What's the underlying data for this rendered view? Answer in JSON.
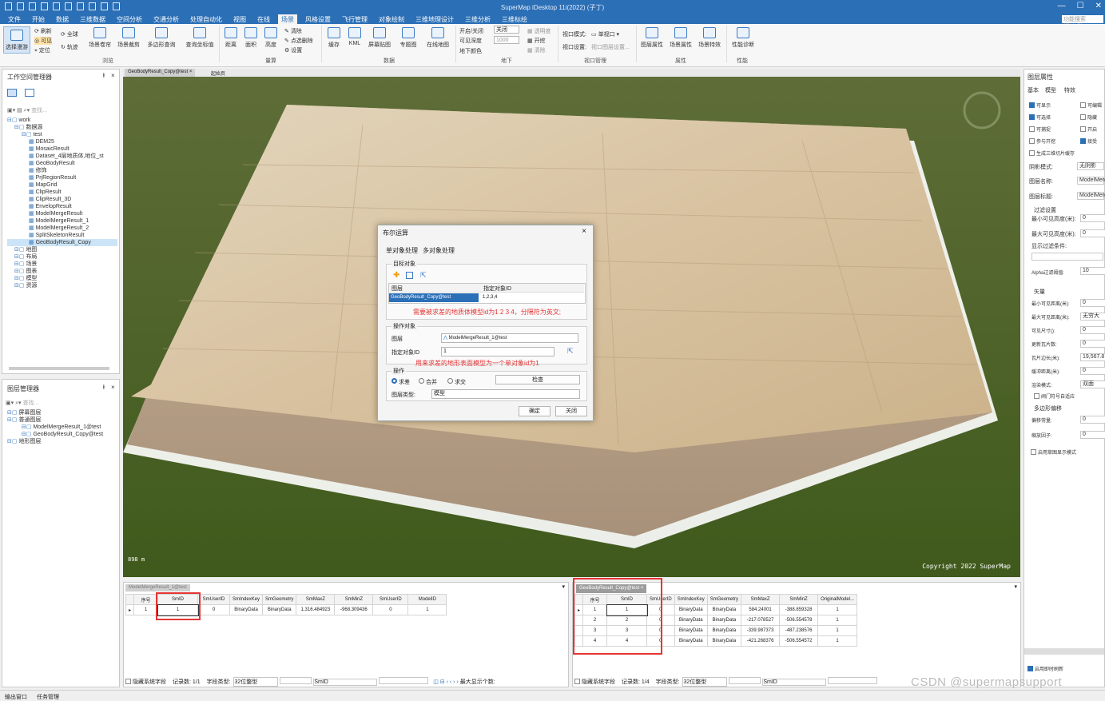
{
  "app": {
    "title": "SuperMap iDesktop 11i(2022) (子丁)"
  },
  "menus": [
    "文件",
    "开始",
    "数据",
    "三维数据",
    "空间分析",
    "交通分析",
    "处理自动化",
    "视图",
    "在线",
    "场景",
    "风格设置",
    "飞行管理",
    "对象绘制",
    "三维地理设计",
    "三维分析",
    "三维标绘"
  ],
  "menu_search_placeholder": "功能搜索 (Ctrl+F)",
  "ribbon": {
    "browse": {
      "select_scene": "选择漫游",
      "refresh": "刷新",
      "visible": "可见",
      "locate": "定位",
      "full": "全球",
      "track": "轨迹",
      "scene_roll": "场景卷帘",
      "scene_spin": "场景裁剪",
      "poly_query": "多边形查询",
      "coord_query": "查询坐标值",
      "group": "浏览"
    },
    "measure": {
      "distance": "距离",
      "area": "面积",
      "height": "高度",
      "clear": "清除",
      "pick_del": "点选删除",
      "settings": "设置",
      "group": "量算"
    },
    "data": {
      "cache": "缓存",
      "kml": "KML",
      "screen_tile": "屏幕贴图",
      "thematic": "专题图",
      "online_map": "在线地图",
      "group": "数据"
    },
    "underground": {
      "open_close": "开启/关闭",
      "close_val": "关闭",
      "visible_depth": "可见深度",
      "depth_val": "1000",
      "surface_color": "地下颜色",
      "transparency": "透明度",
      "excavate": "开挖",
      "clear": "清除",
      "group": "地下"
    },
    "view": {
      "mode": "视口模式:",
      "single": "单视口",
      "settings": "视口设置:",
      "setting_val": "视口图层设置...",
      "group": "视口管理"
    },
    "attr": {
      "layer_attr": "图层属性",
      "scene_attr": "场景属性",
      "scene_fx": "场景特效",
      "group": "属性"
    },
    "perf": {
      "diag": "性能诊断",
      "group": "性能"
    }
  },
  "workspace": {
    "title": "工作空间管理器",
    "search": "查找...",
    "tree": [
      {
        "label": "work",
        "indent": 0
      },
      {
        "label": "数据源",
        "indent": 1
      },
      {
        "label": "test",
        "indent": 2
      },
      {
        "label": "DEM25",
        "indent": 3
      },
      {
        "label": "MosaicResult",
        "indent": 3
      },
      {
        "label": "Dataset_4层地质体,地位_st",
        "indent": 3
      },
      {
        "label": "GeoBodyResult",
        "indent": 3
      },
      {
        "label": "修饰",
        "indent": 3
      },
      {
        "label": "PrjRegionResult",
        "indent": 3
      },
      {
        "label": "MapGrid",
        "indent": 3
      },
      {
        "label": "ClipResult",
        "indent": 3
      },
      {
        "label": "ClipResult_3D",
        "indent": 3
      },
      {
        "label": "EnvelopResult",
        "indent": 3
      },
      {
        "label": "ModelMergeResult",
        "indent": 3
      },
      {
        "label": "ModelMergeResult_1",
        "indent": 3
      },
      {
        "label": "ModelMergeResult_2",
        "indent": 3
      },
      {
        "label": "SplitSkeletonResult",
        "indent": 3
      },
      {
        "label": "GeoBodyResult_Copy",
        "indent": 3,
        "selected": true
      },
      {
        "label": "地图",
        "indent": 1
      },
      {
        "label": "布局",
        "indent": 1
      },
      {
        "label": "场景",
        "indent": 1
      },
      {
        "label": "图表",
        "indent": 1
      },
      {
        "label": "模型",
        "indent": 1
      },
      {
        "label": "资源",
        "indent": 1
      }
    ]
  },
  "layers": {
    "title": "图层管理器",
    "search": "查找...",
    "tree": [
      {
        "label": "屏幕图层",
        "indent": 0
      },
      {
        "label": "普通图层",
        "indent": 0
      },
      {
        "label": "ModelMergeResult_1@test",
        "indent": 2
      },
      {
        "label": "GeoBodyResult_Copy@test",
        "indent": 2
      },
      {
        "label": "地形图层",
        "indent": 0
      }
    ]
  },
  "tabs": {
    "scene_tab": "GeoBodyResult_Copy@test",
    "start_tab": "起始页"
  },
  "viewport": {
    "copyright": "Copyright 2022 SuperMap",
    "scale": "898 m"
  },
  "dialog": {
    "title": "布尔运算",
    "tab1": "单对象处理",
    "tab2": "多对象处理",
    "target_group": "目标对象",
    "col_layer": "图层",
    "col_id": "指定对象ID",
    "target_layer": "GeoBodyResult_Copy@test",
    "target_ids": "1,2,3,4",
    "annot1": "需要被求差的地质体模型id为1 2 3 4，分隔符为英文;",
    "op_group": "操作对象",
    "layer_label": "图层",
    "op_layer": "ModelMergeResult_1@test",
    "id_label": "指定对象ID",
    "op_id": "1",
    "annot2": "用来求差的地形表面模型为一个单对象id为1",
    "operation": "操作",
    "opt_diff": "求差",
    "opt_union": "合并",
    "opt_intersect": "求交",
    "check": "检查",
    "layer_type_label": "图层类型:",
    "layer_type": "模型",
    "ok": "确定",
    "close": "关闭"
  },
  "table_left": {
    "tab": "ModelMergeResult_1@test",
    "columns": [
      "序号",
      "SmID",
      "SmUserID",
      "SmIndexKey",
      "SmGeometry",
      "SmMaxZ",
      "SmMinZ",
      "SmUserID",
      "ModelID"
    ],
    "rows": [
      [
        "1",
        "1",
        "0",
        "BinaryData",
        "BinaryData",
        "1,316.484923",
        "-968.309436",
        "0",
        "1"
      ]
    ],
    "footer": {
      "hide_sys": "隐藏系统字段",
      "count_label": "记录数:",
      "count": "1/1",
      "field_type_label": "字段类型:",
      "field_type": "32位整型",
      "field": "SmID",
      "max_label": "最大显示个数:"
    }
  },
  "table_right": {
    "tab": "GeoBodyResult_Copy@test",
    "columns": [
      "序号",
      "SmID",
      "SmUserID",
      "SmIndexKey",
      "SmGeometry",
      "SmMaxZ",
      "SmMinZ",
      "OriginalModel..."
    ],
    "rows": [
      [
        "1",
        "1",
        "0",
        "BinaryData",
        "BinaryData",
        "584.24001",
        "-388.859328",
        "1"
      ],
      [
        "2",
        "2",
        "0",
        "BinaryData",
        "BinaryData",
        "-217.078527",
        "-506.554578",
        "1"
      ],
      [
        "3",
        "3",
        "0",
        "BinaryData",
        "BinaryData",
        "-339.987373",
        "-487.238576",
        "1"
      ],
      [
        "4",
        "4",
        "0",
        "BinaryData",
        "BinaryData",
        "-421.268376",
        "-506.554572",
        "1"
      ]
    ],
    "footer": {
      "hide_sys": "隐藏系统字段",
      "count_label": "记录数:",
      "count": "1/4",
      "field_type_label": "字段类型:",
      "field_type": "32位整型",
      "field": "SmID"
    }
  },
  "props": {
    "title": "图层属性",
    "tabs": [
      "基本",
      "模型",
      "特效"
    ],
    "checks": [
      [
        "可显示",
        true
      ],
      [
        "可编辑",
        false
      ],
      [
        "可选择",
        true
      ],
      [
        "隐藏",
        false
      ],
      [
        "可捕捉",
        false
      ],
      [
        "开启",
        false
      ],
      [
        "参与开挖",
        false
      ],
      [
        "接受",
        true
      ],
      [
        "生成三维切片缓存",
        false
      ]
    ],
    "shadow_label": "阴影模式:",
    "shadow": "无阴影",
    "name_label": "图层名称:",
    "name": "ModelMerg",
    "caption_label": "图层标题:",
    "caption": "ModelMerg",
    "filter_title": "过滤设置",
    "min_vis": "最小可见高度(米):",
    "min_vis_v": "0",
    "max_vis": "最大可见高度(米):",
    "max_vis_v": "0",
    "filter_cond": "显示过滤条件:",
    "alpha": "Alpha过滤阈值:",
    "alpha_v": "10",
    "vector_title": "矢量",
    "min_dist": "最小可见距离(米):",
    "min_dist_v": "0",
    "max_dist": "最大可见距离(米):",
    "max_dist_v": "无穷大",
    "vis_size": "可见尺寸():",
    "vis_size_v": "0",
    "update_tiles": "更新瓦片数:",
    "update_tiles_v": "0",
    "tile_edge": "瓦片边长(米):",
    "tile_edge_v": "19,567.8",
    "buffer": "缓冲距离(米):",
    "buffer_v": "0",
    "render": "渲染模式:",
    "render_v": "双面",
    "valve": "阀门符号自适应",
    "poly_title": "多边形偏移",
    "offset": "偏移常量:",
    "offset_v": "0",
    "scale": "缩放因子:",
    "scale_v": "0",
    "sketch": "启用草图显示模式",
    "refresh": "启用即时刷新"
  },
  "statusbar": {
    "output": "输出窗口",
    "tasks": "任务管理"
  },
  "watermark": "CSDN @supermapsupport"
}
